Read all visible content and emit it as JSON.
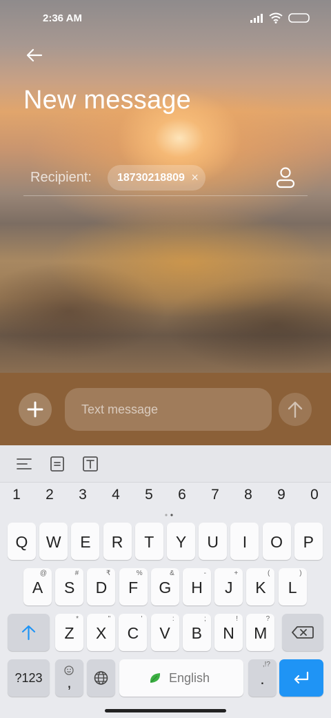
{
  "status_bar": {
    "time": "2:36 AM"
  },
  "header": {
    "title": "New message"
  },
  "recipient": {
    "label": "Recipient:",
    "chip_number": "18730218809",
    "remove_glyph": "×"
  },
  "compose": {
    "placeholder": "Text message"
  },
  "keyboard": {
    "numbers": [
      "1",
      "2",
      "3",
      "4",
      "5",
      "6",
      "7",
      "8",
      "9",
      "0"
    ],
    "row1": [
      "Q",
      "W",
      "E",
      "R",
      "T",
      "Y",
      "U",
      "I",
      "O",
      "P"
    ],
    "row2": [
      {
        "key": "A",
        "sup": "@"
      },
      {
        "key": "S",
        "sup": "#"
      },
      {
        "key": "D",
        "sup": "₹"
      },
      {
        "key": "F",
        "sup": "%"
      },
      {
        "key": "G",
        "sup": "&"
      },
      {
        "key": "H",
        "sup": "-"
      },
      {
        "key": "J",
        "sup": "+"
      },
      {
        "key": "K",
        "sup": "("
      },
      {
        "key": "L",
        "sup": ")"
      }
    ],
    "row3": [
      {
        "key": "Z",
        "sup": "*"
      },
      {
        "key": "X",
        "sup": "\""
      },
      {
        "key": "C",
        "sup": "'"
      },
      {
        "key": "V",
        "sup": ":"
      },
      {
        "key": "B",
        "sup": ";"
      },
      {
        "key": "N",
        "sup": "!"
      },
      {
        "key": "M",
        "sup": "?"
      }
    ],
    "symbols_label": "?123",
    "comma_label": ",",
    "space_label": "English",
    "period_label": ".",
    "period_sup": ",!?"
  },
  "colors": {
    "accent": "#1f94f5",
    "compose_bar": "#8b6038",
    "keyboard_bg": "#e9eaee"
  }
}
